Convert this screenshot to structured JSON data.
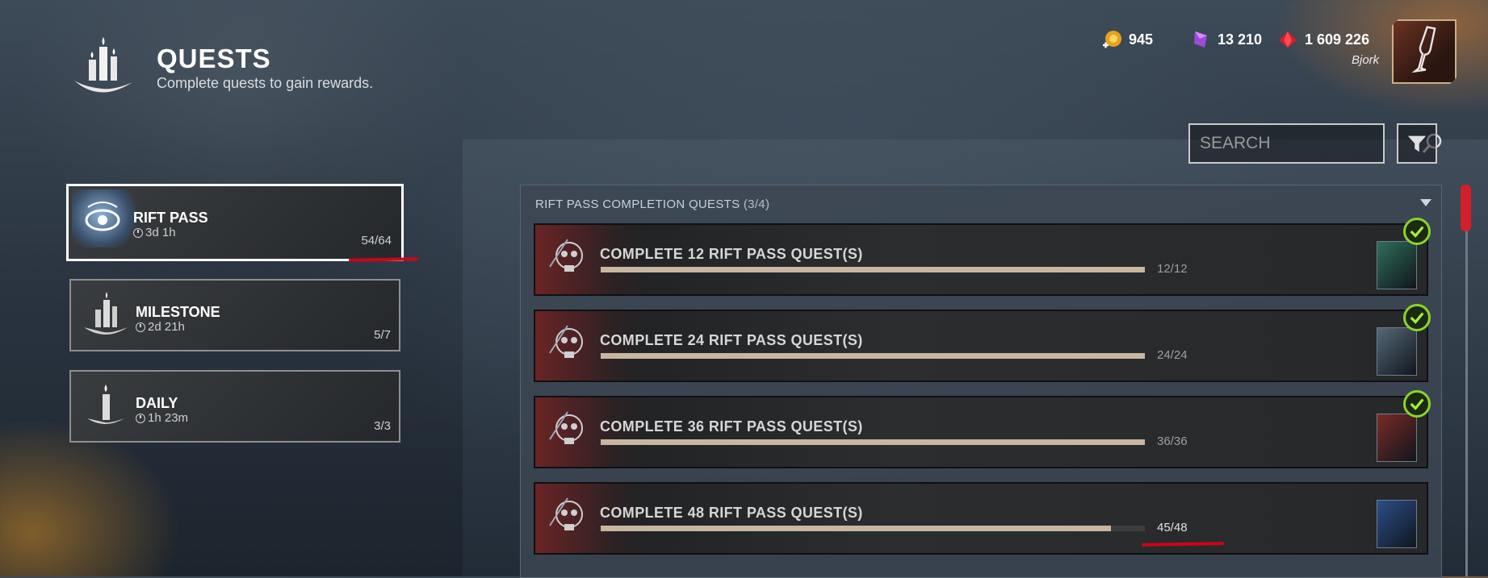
{
  "header": {
    "title": "QUESTS",
    "subtitle": "Complete quests to gain rewards.",
    "header_icon": "candles-icon"
  },
  "currencies": [
    {
      "icon": "auric-cell-plus-icon",
      "value": "945",
      "color": "#e6a21c"
    },
    {
      "icon": "iridescent-shard-icon",
      "value": "13 210",
      "color": "#a04ad8"
    },
    {
      "icon": "bloodpoints-icon",
      "value": "1 609 226",
      "color": "#d41f2b"
    }
  ],
  "profile": {
    "name": "Bjork",
    "avatar_icon": "champagne-glass-icon"
  },
  "categories": [
    {
      "name": "RIFT PASS",
      "timer": "3d 1h",
      "count": "54/64",
      "icon": "eye-emblem-icon",
      "active": true
    },
    {
      "name": "MILESTONE",
      "timer": "2d 21h",
      "count": "5/7",
      "icon": "candles-icon",
      "active": false
    },
    {
      "name": "DAILY",
      "timer": "1h 23m",
      "count": "3/3",
      "icon": "candle-icon",
      "active": false
    }
  ],
  "search": {
    "placeholder": "SEARCH"
  },
  "section": {
    "title": "RIFT PASS COMPLETION QUESTS",
    "count": "(3/4)"
  },
  "quests": [
    {
      "title": "COMPLETE 12 RIFT PASS QUEST(S)",
      "progress": "12/12",
      "fraction": 1.0,
      "completed": true,
      "reward_color": "#2f6e5a"
    },
    {
      "title": "COMPLETE 24 RIFT PASS QUEST(S)",
      "progress": "24/24",
      "fraction": 1.0,
      "completed": true,
      "reward_color": "#556877"
    },
    {
      "title": "COMPLETE 36 RIFT PASS QUEST(S)",
      "progress": "36/36",
      "fraction": 1.0,
      "completed": true,
      "reward_color": "#7a2a26"
    },
    {
      "title": "COMPLETE 48 RIFT PASS QUEST(S)",
      "progress": "45/48",
      "fraction": 0.9375,
      "completed": false,
      "reward_color": "#2a4e8a"
    }
  ]
}
